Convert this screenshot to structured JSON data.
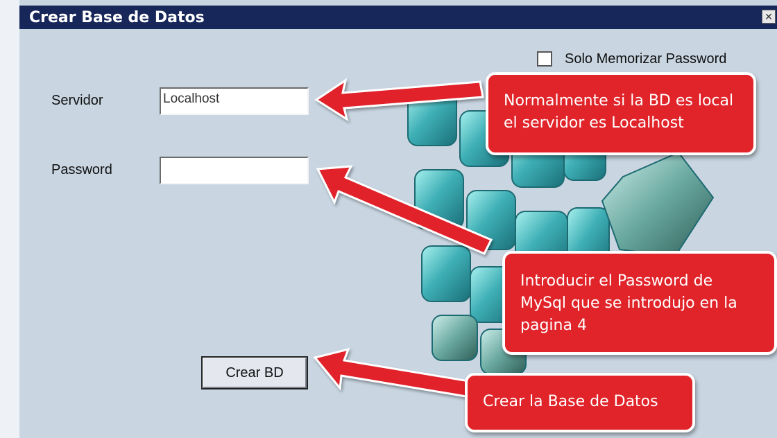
{
  "window": {
    "title": "Crear Base de Datos",
    "close_glyph": "✕"
  },
  "form": {
    "memorize_label": "Solo Memorizar Password",
    "memorize_checked": false,
    "server_label": "Servidor",
    "server_value": "Localhost",
    "password_label": "Password",
    "password_value": "",
    "create_button": "Crear BD"
  },
  "callouts": {
    "server_note": "Normalmente si la BD es local el servidor es Localhost",
    "password_note": "Introducir el Password de MySql que se introdujo en la pagina 4",
    "create_note": "Crear la Base de Datos"
  },
  "colors": {
    "titlebar": "#17275a",
    "background": "#c9d6e2",
    "callout": "#e1242a",
    "cube": "#3fb0b6"
  }
}
